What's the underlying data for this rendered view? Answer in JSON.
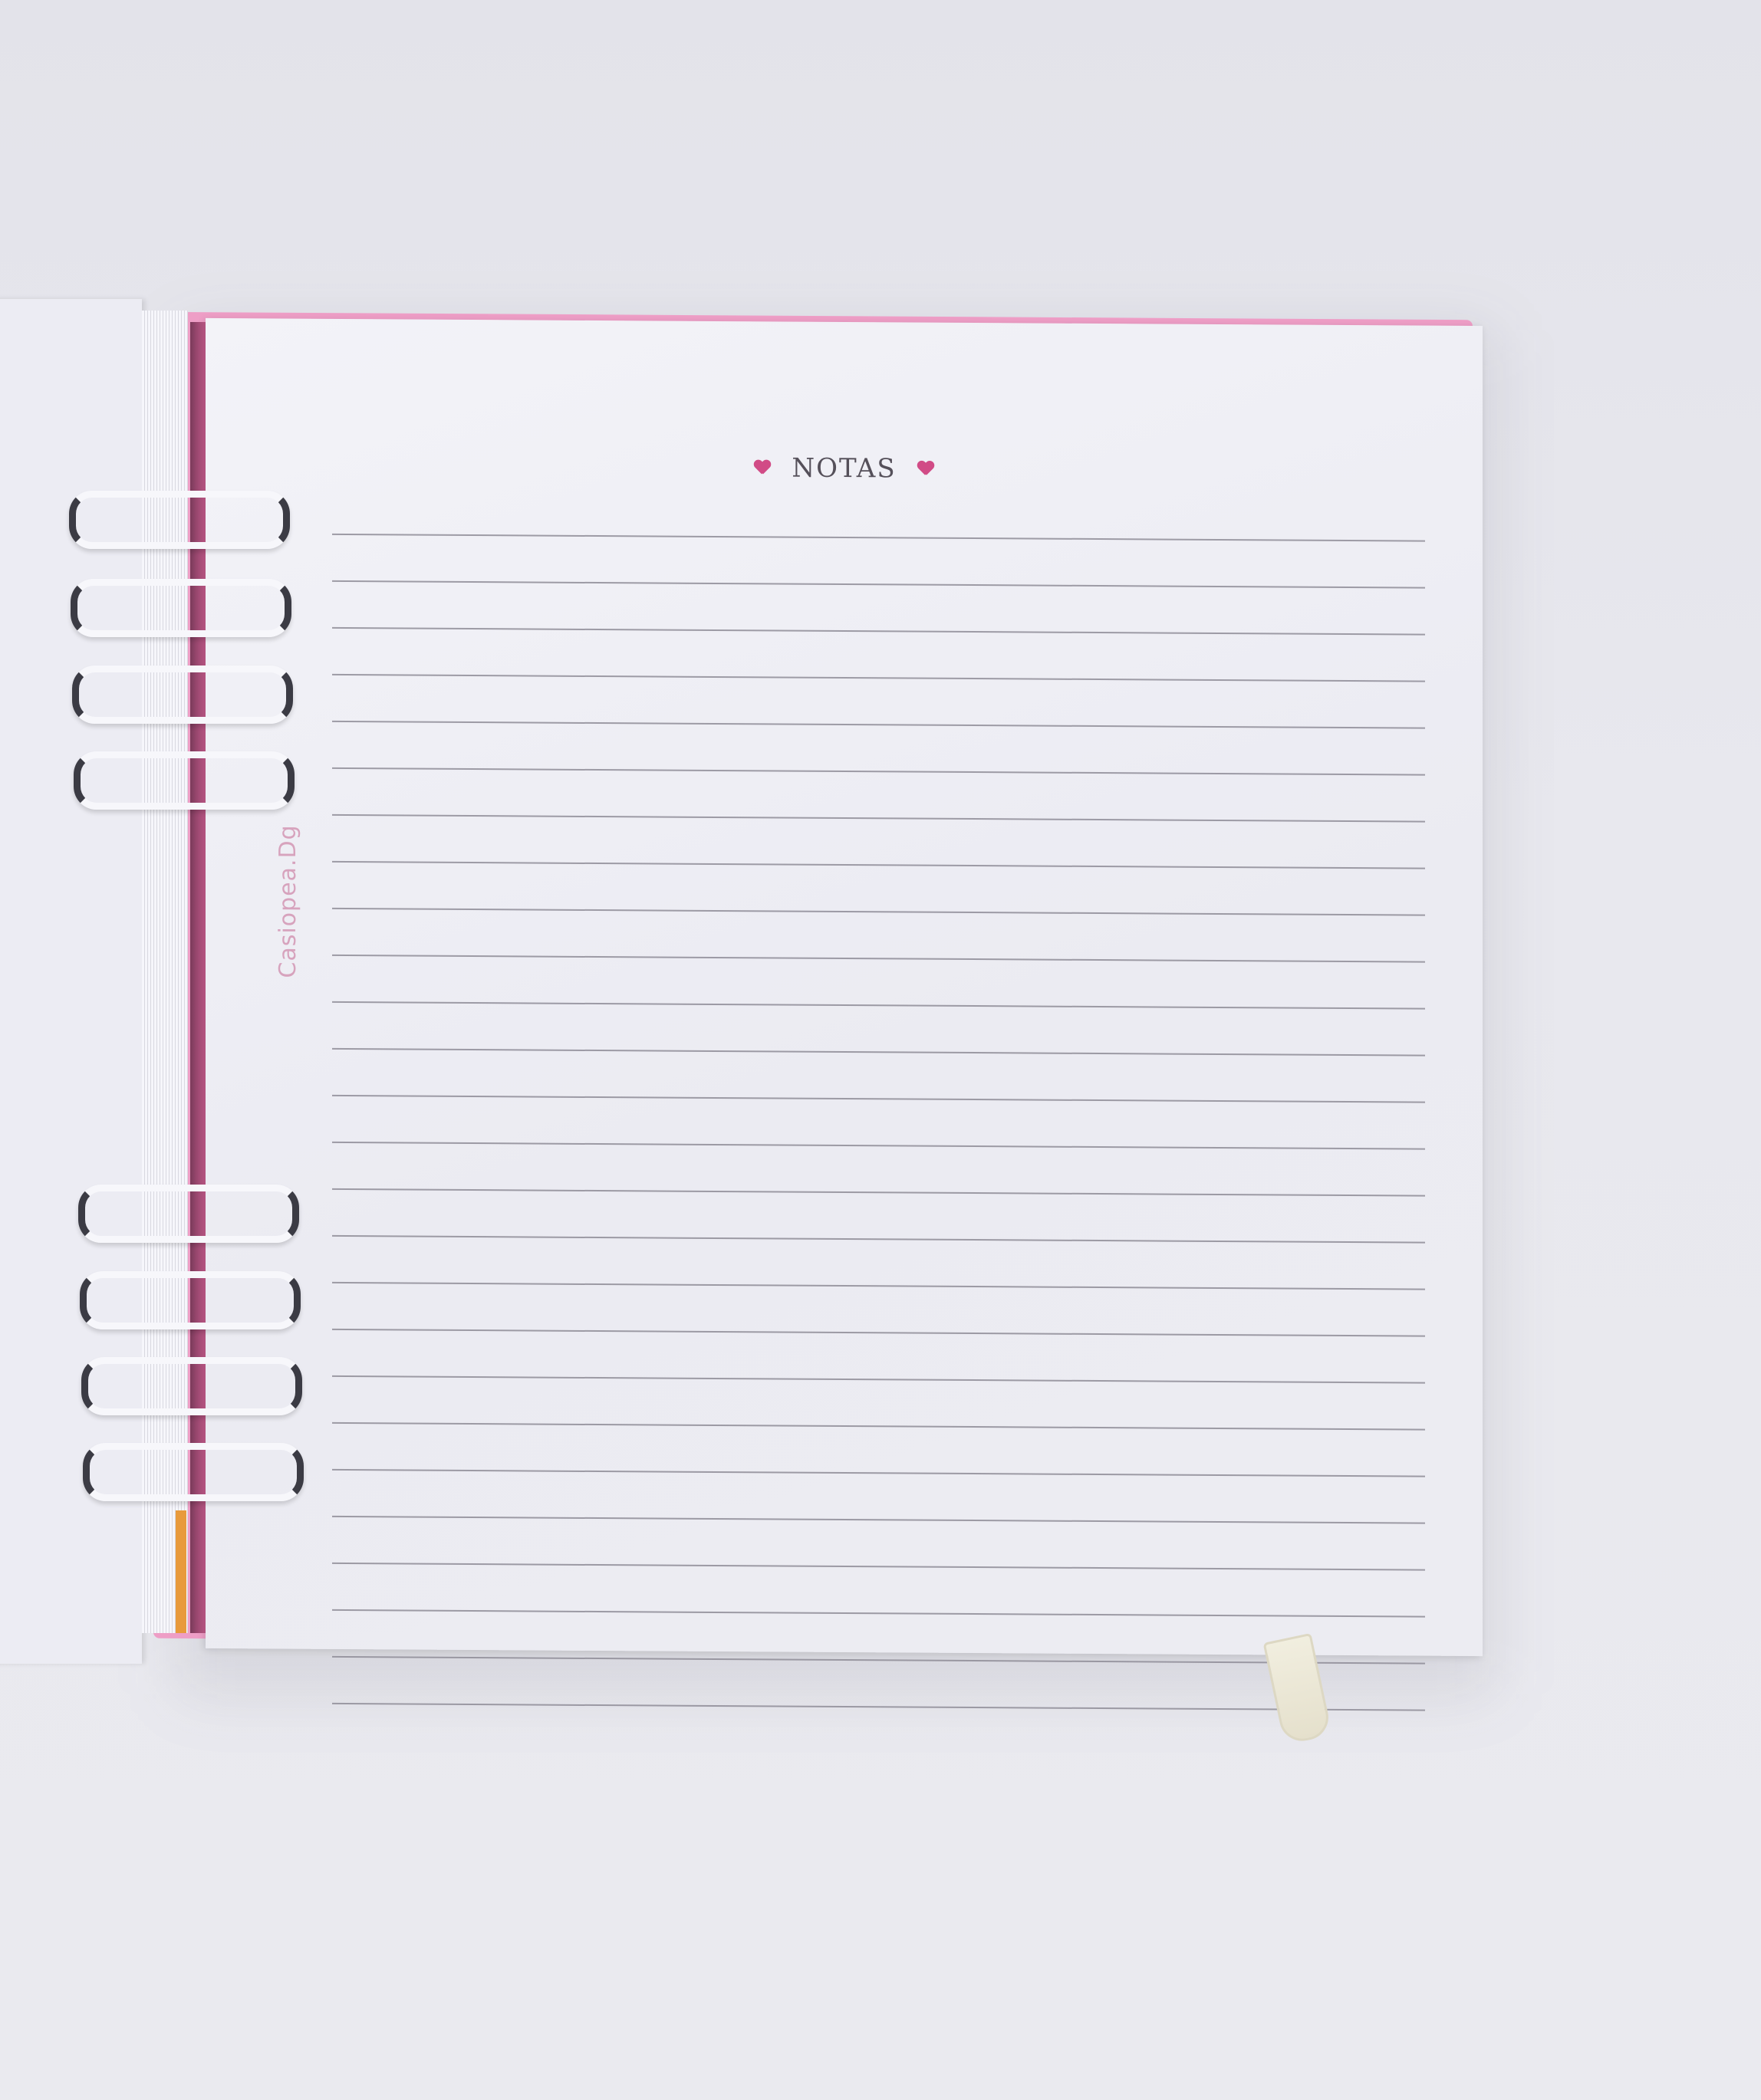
{
  "notebook": {
    "header": {
      "title": "NOTAS",
      "left_icon": "heart-icon",
      "right_icon": "heart-icon",
      "heart_color": "#d14b86"
    },
    "brand_text": "Casiopea.Dg",
    "cover_color": "#ee9ec6",
    "page_color": "#f0f0f6",
    "rule_color": "#8e8c96"
  }
}
